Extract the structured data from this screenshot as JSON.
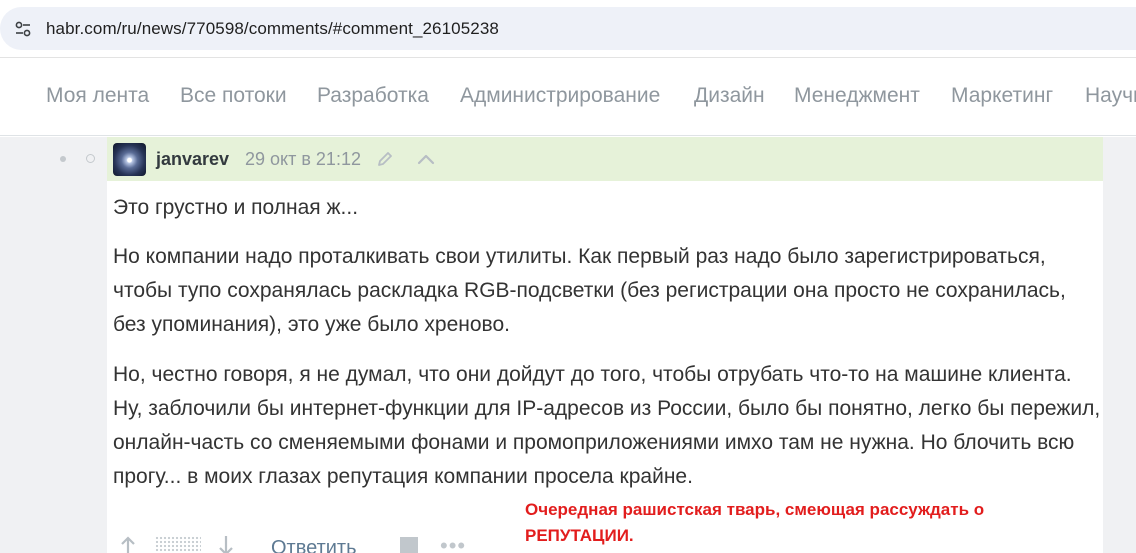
{
  "browser": {
    "url": "habr.com/ru/news/770598/comments/#comment_26105238",
    "site_icon": "tune-icon"
  },
  "nav": {
    "items": [
      "Моя лента",
      "Все потоки",
      "Разработка",
      "Администрирование",
      "Дизайн",
      "Менеджмент",
      "Маркетинг",
      "Научпоп"
    ]
  },
  "comment": {
    "author": "janvarev",
    "date": "29 окт в 21:12",
    "paragraphs": [
      "Это грустно и полная ж...",
      "Но компании надо проталкивать свои утилиты. Как первый раз надо было зарегистрироваться, чтобы тупо сохранялась раскладка RGB-подсветки (без регистрации она просто не сохранилась, без упоминания), это уже было хреново.",
      "Но, честно говоря, я не думал, что они дойдут до того, чтобы отрубать что-то на машине клиента. Ну, заблочили бы интернет-функции для IP-адресов из России, было бы понятно, легко бы пережил, онлайн-часть со сменяемыми фонами и промоприложениями имхо там не нужна. Но блочить всю прогу... в моих глазах репутация компании просела крайне."
    ],
    "reply_label": "Ответить",
    "more_label": "•••"
  },
  "annotation": {
    "text": "Очередная рашистская тварь, смеющая рассуждать о РЕПУТАЦИИ.",
    "color": "#e21d1d"
  },
  "colors": {
    "header_bg": "#e6f2d9",
    "link": "#5e7a93",
    "nav_text": "#8f979e"
  }
}
